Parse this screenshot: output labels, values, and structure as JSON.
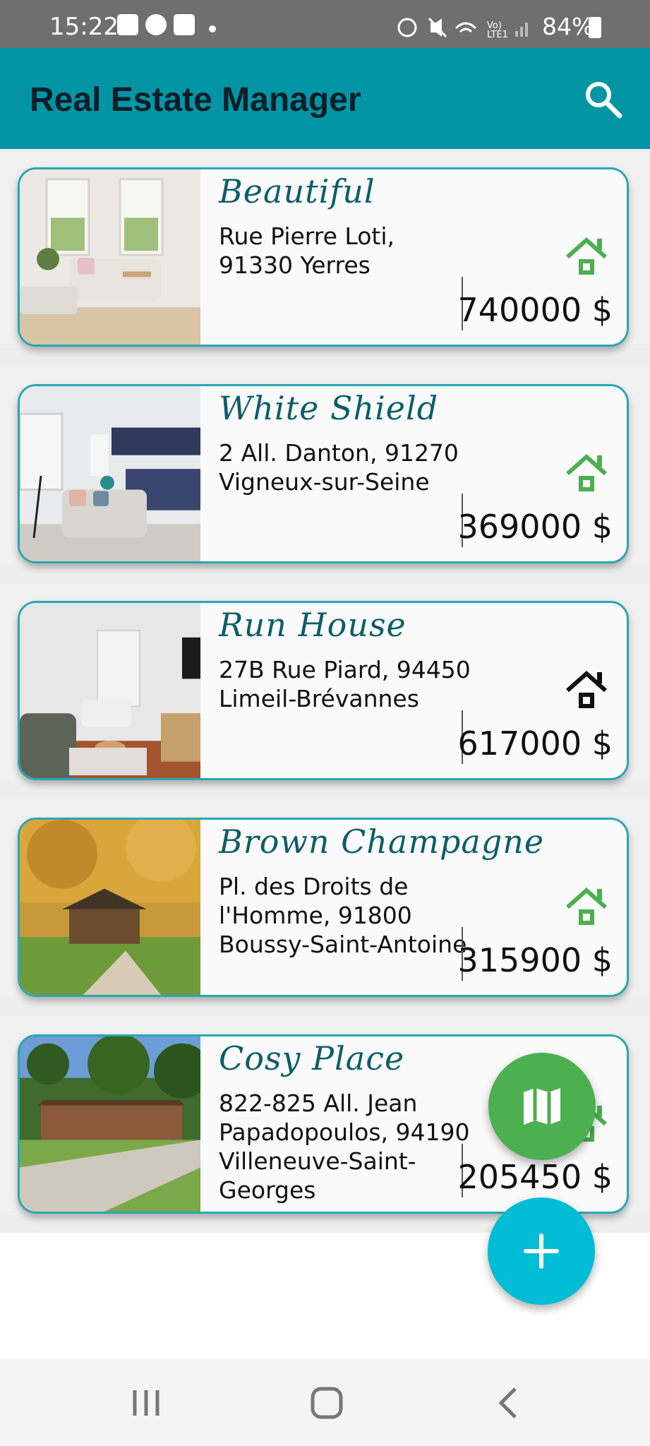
{
  "status_bar": {
    "time": "15:22",
    "battery": "84%"
  },
  "app_bar": {
    "title": "Real Estate Manager",
    "search_icon": "search-icon"
  },
  "properties": [
    {
      "name": "Beautiful",
      "address": "Rue Pierre Loti, 91330 Yerres",
      "price": "740000 $",
      "status_color": "#4caf50",
      "photo": "living-room-photo"
    },
    {
      "name": "White Shield",
      "address": "2 All. Danton, 91270 Vigneux-sur-Seine",
      "price": "369000 $",
      "status_color": "#4caf50",
      "photo": "open-kitchen-photo"
    },
    {
      "name": "Run House",
      "address": "27B Rue Piard, 94450 Limeil-Brévannes",
      "price": "617000 $",
      "status_color": "#111111",
      "photo": "lounge-photo"
    },
    {
      "name": "Brown Champagne",
      "address": "Pl. des Droits de l'Homme, 91800 Boussy-Saint-Antoine",
      "price": "315900 $",
      "status_color": "#4caf50",
      "photo": "autumn-cabin-photo"
    },
    {
      "name": "Cosy Place",
      "address": "822-825 All. Jean Papadopoulos, 94190 Villeneuve-Saint-Georges",
      "price": "205450 $",
      "status_color": "#4caf50",
      "photo": "wooden-house-photo"
    }
  ],
  "fabs": {
    "map_icon": "map-icon",
    "add_icon": "plus-icon"
  },
  "colors": {
    "app_bar": "#0495a4",
    "card_border": "#2aa7b2",
    "name_text": "#0c5e6a",
    "map_fab": "#4caf50",
    "add_fab": "#00bcd4"
  }
}
